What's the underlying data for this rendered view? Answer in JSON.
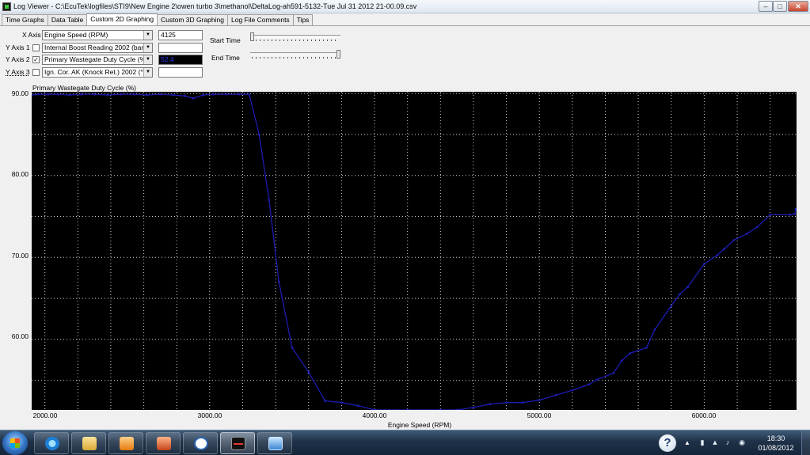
{
  "window": {
    "title": "Log Viewer - C:\\EcuTek\\logfiles\\STI9\\New Engine 2\\owen turbo 3\\methanol\\DeltaLog-ah591-5132-Tue Jul 31 2012 21-00.09.csv",
    "min_glyph": "–",
    "max_glyph": "□",
    "close_glyph": "✕"
  },
  "tabs": [
    {
      "label": "Time Graphs"
    },
    {
      "label": "Data Table"
    },
    {
      "label": "Custom 2D Graphing"
    },
    {
      "label": "Custom 3D Graphing"
    },
    {
      "label": "Log File Comments"
    },
    {
      "label": "Tips"
    }
  ],
  "active_tab": "Custom 2D Graphing",
  "axes": {
    "x": {
      "label": "X Axis",
      "value": "Engine Speed (RPM)",
      "readout": "4125"
    },
    "y1": {
      "label": "Y Axis 1",
      "checked": false,
      "value": "Internal Boost Reading 2002 (bar)",
      "readout": ""
    },
    "y2": {
      "label": "Y Axis 2",
      "checked": true,
      "value": "Primary Wastegate Duty Cycle (%)",
      "readout": "52.4"
    },
    "y3": {
      "label": "Y Axis 3",
      "checked": false,
      "value": "Ign. Cor. AK (Knock Ret.) 2002 (°)",
      "readout": ""
    }
  },
  "check_glyph": "✓",
  "dropdown_glyph": "▼",
  "time": {
    "start_label": "Start Time",
    "end_label": "End Time",
    "start_position": 0,
    "end_position": 1
  },
  "chart_data": {
    "type": "line",
    "title": "Primary Wastegate Duty Cycle (%)",
    "xlabel": "Engine Speed (RPM)",
    "ylabel": "",
    "xlim": [
      1920,
      6560
    ],
    "ylim": [
      51.4,
      90.2
    ],
    "x_ticks": [
      "2000.00",
      "3000.00",
      "4000.00",
      "5000.00",
      "6000.00"
    ],
    "y_ticks": [
      "90.00",
      "80.00",
      "70.00",
      "60.00"
    ],
    "grid": true,
    "line_color": "#1c1cb0",
    "background": "#000000",
    "x": [
      1920,
      1960,
      2020,
      2080,
      2150,
      2220,
      2300,
      2380,
      2460,
      2540,
      2620,
      2700,
      2780,
      2850,
      2900,
      2960,
      3020,
      3100,
      3180,
      3240,
      3300,
      3360,
      3420,
      3500,
      3600,
      3700,
      3800,
      3900,
      4000,
      4200,
      4400,
      4500,
      4600,
      4700,
      4800,
      4900,
      5000,
      5100,
      5200,
      5300,
      5350,
      5450,
      5500,
      5550,
      5650,
      5700,
      5800,
      5850,
      5900,
      6000,
      6080,
      6120,
      6180,
      6260,
      6320,
      6400,
      6520,
      6550,
      6555
    ],
    "y": [
      89.8,
      89.9,
      89.9,
      89.9,
      89.8,
      89.9,
      89.9,
      89.8,
      89.9,
      89.9,
      89.8,
      89.9,
      89.8,
      89.7,
      89.4,
      89.8,
      89.9,
      89.9,
      89.9,
      89.9,
      85.0,
      77.0,
      67.0,
      59.0,
      56.0,
      52.5,
      52.3,
      51.9,
      51.4,
      51.4,
      51.4,
      51.4,
      51.7,
      52.1,
      52.3,
      52.3,
      52.6,
      53.2,
      53.8,
      54.5,
      55.1,
      55.9,
      57.4,
      58.3,
      59.0,
      61.2,
      64.1,
      65.5,
      66.4,
      69.2,
      70.3,
      71.0,
      72.1,
      72.9,
      73.7,
      75.2,
      75.2,
      75.3,
      75.9
    ]
  },
  "taskbar": {
    "help_glyph": "?",
    "tray_arrow": "▲",
    "time": "18:30",
    "date": "01/08/2012"
  }
}
